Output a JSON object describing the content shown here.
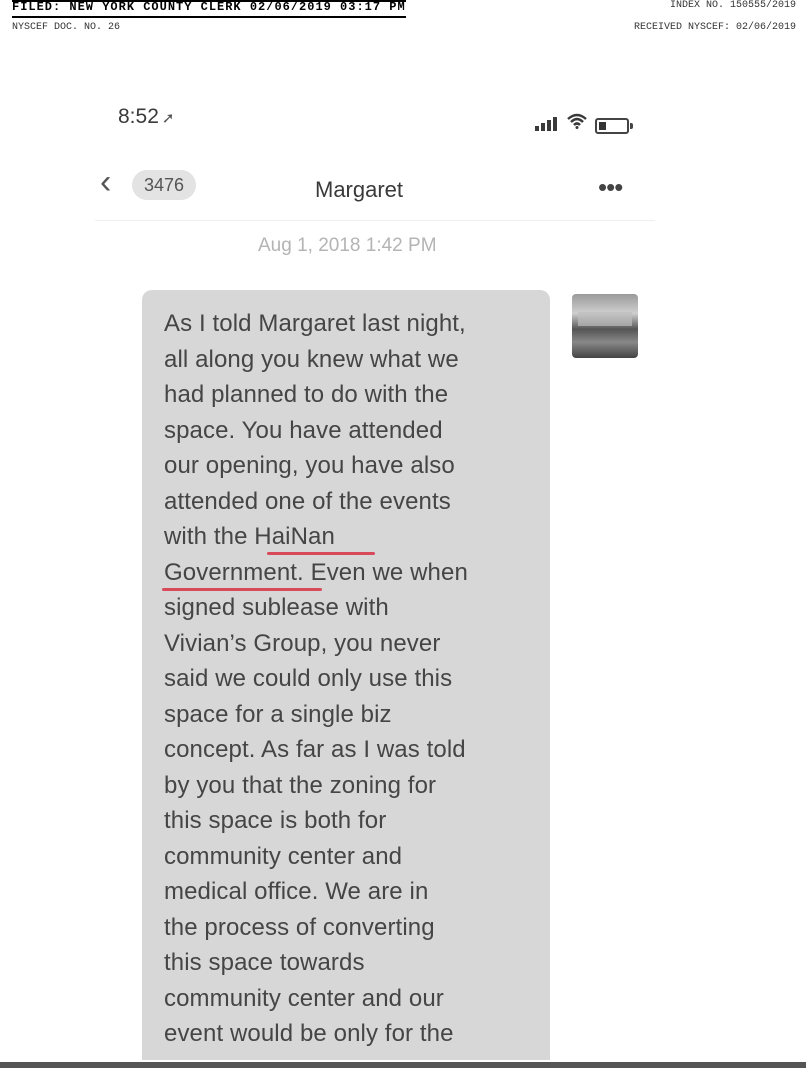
{
  "filing_header": {
    "filed_line": "FILED: NEW YORK COUNTY CLERK 02/06/2019 03:17 PM",
    "index_no": "INDEX NO. 150555/2019",
    "doc_no": "NYSCEF DOC. NO. 26",
    "received": "RECEIVED NYSCEF: 02/06/2019"
  },
  "status_bar": {
    "time": "8:52",
    "location_icon": "location-arrow-icon",
    "icons": [
      "signal-icon",
      "wifi-icon",
      "battery-icon"
    ]
  },
  "nav": {
    "back_icon": "chevron-left-icon",
    "back_count": "3476",
    "contact_name": "Margaret",
    "more_icon": "ellipsis-icon"
  },
  "conversation": {
    "timestamp": "Aug 1, 2018 1:42 PM",
    "message_lines": [
      "As I told Margaret last night,",
      "all along you knew what we",
      "had planned to do with the",
      "space. You have attended",
      "our opening, you have also",
      "attended one of the events",
      "with the HaiNan",
      "Government. Even we when",
      "signed sublease with",
      "Vivian’s Group, you never",
      "said we could only use this",
      "space for a single biz",
      "concept. As far as I was told",
      "by you that the zoning for",
      "this space is both for",
      "community center and",
      "medical office. We are in",
      "the process of converting",
      "this space towards",
      "community center and our",
      "event would be only for the"
    ],
    "underline_color": "#d84a5a",
    "bubble_color": "#d7d7d7"
  }
}
